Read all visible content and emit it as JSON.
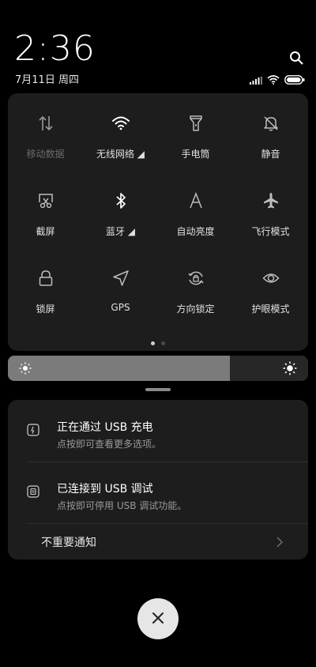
{
  "status": {
    "time": "2:36",
    "date": "7月11日 周四"
  },
  "quick_settings": {
    "tiles": [
      {
        "label": "移动数据",
        "icon": "mobile-data-icon",
        "enabled": false
      },
      {
        "label": "无线网络 ◢",
        "icon": "wifi-icon",
        "enabled": true
      },
      {
        "label": "手电筒",
        "icon": "flashlight-icon",
        "enabled": true
      },
      {
        "label": "静音",
        "icon": "bell-off-icon",
        "enabled": true
      },
      {
        "label": "截屏",
        "icon": "screenshot-icon",
        "enabled": true
      },
      {
        "label": "蓝牙 ◢",
        "icon": "bluetooth-icon",
        "enabled": true
      },
      {
        "label": "自动亮度",
        "icon": "auto-brightness-icon",
        "enabled": true
      },
      {
        "label": "飞行模式",
        "icon": "airplane-icon",
        "enabled": true
      },
      {
        "label": "锁屏",
        "icon": "lock-icon",
        "enabled": true
      },
      {
        "label": "GPS",
        "icon": "gps-icon",
        "enabled": true
      },
      {
        "label": "方向锁定",
        "icon": "rotation-lock-icon",
        "enabled": true
      },
      {
        "label": "护眼模式",
        "icon": "eye-icon",
        "enabled": true
      }
    ],
    "pages": 2,
    "current_page": 1
  },
  "brightness": {
    "level": 0.74
  },
  "notifications": [
    {
      "title": "正在通过 USB 充电",
      "subtitle": "点按即可查看更多选项。",
      "icon": "usb-charge-icon"
    },
    {
      "title": "已连接到 USB 调试",
      "subtitle": "点按即可停用 USB 调试功能。",
      "icon": "usb-debug-icon"
    }
  ],
  "unimportant_notifications": {
    "label": "不重要通知"
  },
  "colors": {
    "panel": "#1d1d1d",
    "brightness_fill": "#7b7b7b"
  }
}
